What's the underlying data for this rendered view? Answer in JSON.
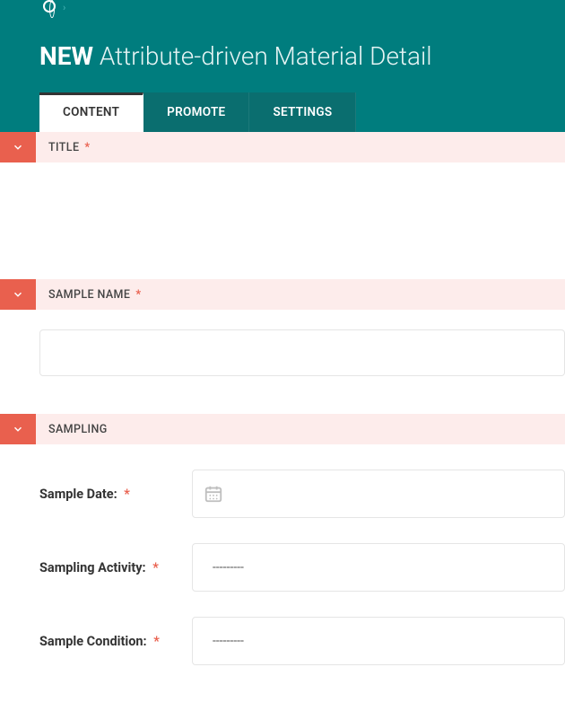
{
  "page": {
    "new_label": "NEW",
    "title_rest": " Attribute-driven Material Detail"
  },
  "tabs": {
    "content": "CONTENT",
    "promote": "PROMOTE",
    "settings": "SETTINGS"
  },
  "sections": {
    "title": {
      "label": "TITLE",
      "required": "*"
    },
    "sample_name": {
      "label": "SAMPLE NAME",
      "required": "*"
    },
    "sampling": {
      "label": "SAMPLING"
    }
  },
  "fields": {
    "sample_date": {
      "label": "Sample Date:",
      "required": "*"
    },
    "sampling_activity": {
      "label": "Sampling Activity:",
      "required": "*",
      "value": "---------"
    },
    "sample_condition": {
      "label": "Sample Condition:",
      "required": "*",
      "value": "---------"
    },
    "sample_name_value": ""
  }
}
